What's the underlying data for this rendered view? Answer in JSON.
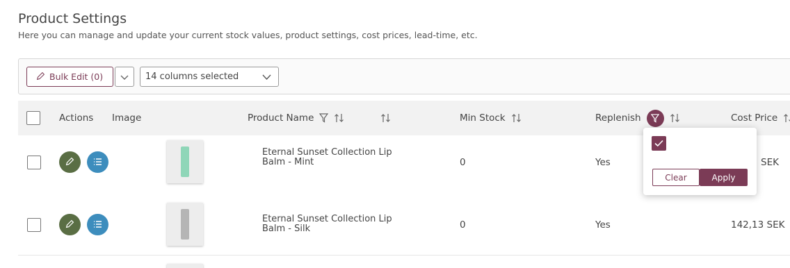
{
  "page": {
    "title": "Product Settings",
    "subtitle": "Here you can manage and update your current stock values, product settings, cost prices, lead-time, etc."
  },
  "toolbar": {
    "bulk_edit_label": "Bulk Edit (0)",
    "columns_selected": "14 columns selected"
  },
  "table": {
    "headers": {
      "actions": "Actions",
      "image": "Image",
      "product_name": "Product Name",
      "min_stock": "Min Stock",
      "replenish": "Replenish",
      "cost_price": "Cost Price"
    },
    "rows": [
      {
        "product_name": "Eternal Sunset Collection Lip Balm - Mint",
        "min_stock": "0",
        "replenish": "Yes",
        "cost_price": "SEK",
        "tube_color": "#8fd6b8"
      },
      {
        "product_name": "Eternal Sunset Collection Lip Balm - Silk",
        "min_stock": "0",
        "replenish": "Yes",
        "cost_price": "142,13 SEK",
        "tube_color": "#b5b5b5"
      }
    ]
  },
  "filter_popup": {
    "checked": true,
    "clear_label": "Clear",
    "apply_label": "Apply"
  },
  "colors": {
    "accent": "#7b3b56",
    "edit": "#5a6e44",
    "info": "#3d8dbd"
  },
  "icons": [
    "pencil-icon",
    "chevron-down-icon",
    "filter-icon",
    "sort-icon",
    "list-icon",
    "check-icon"
  ]
}
